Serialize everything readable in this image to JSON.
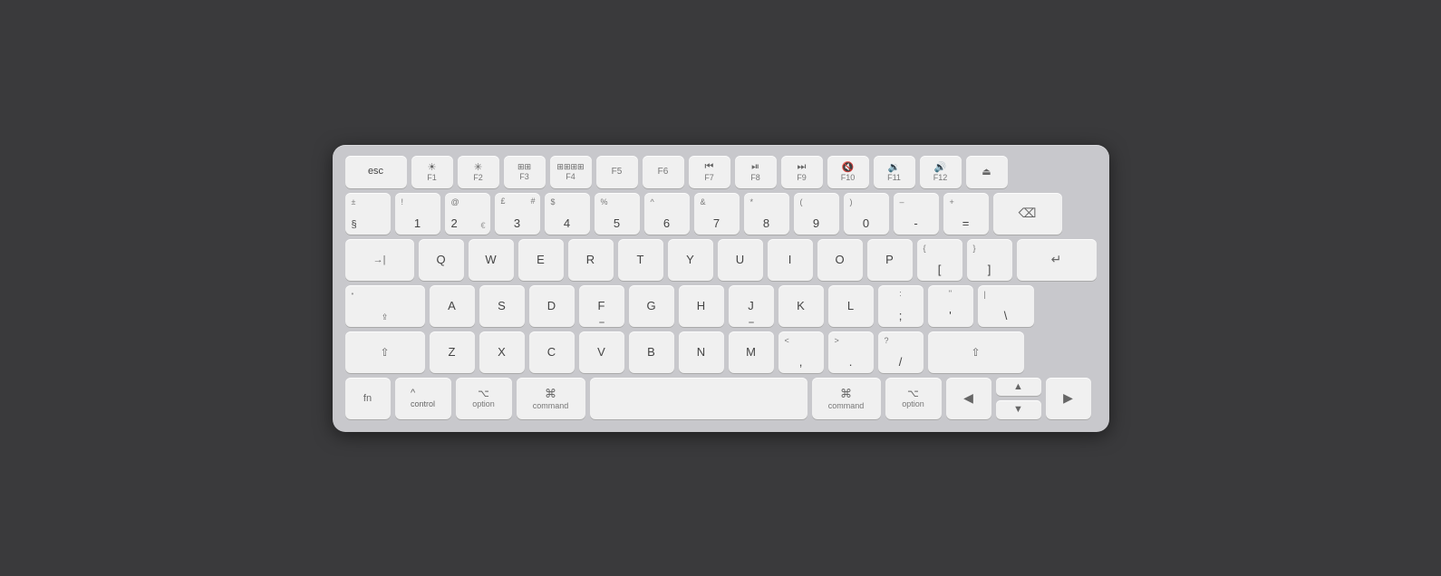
{
  "keyboard": {
    "background_color": "#c8c8cc",
    "rows": {
      "fn_row": [
        "esc",
        "F1",
        "F2",
        "F3",
        "F4",
        "F5",
        "F6",
        "F7",
        "F8",
        "F9",
        "F10",
        "F11",
        "F12",
        "eject"
      ],
      "num_row": [
        "§±",
        "1!",
        "2@€",
        "3#£",
        "4$",
        "5%",
        "6^",
        "7&",
        "8*",
        "9(",
        "0)",
        "-–",
        "+=",
        "delete"
      ],
      "qwerty_row": [
        "tab",
        "Q",
        "W",
        "E",
        "R",
        "T",
        "Y",
        "U",
        "I",
        "O",
        "P",
        "[{",
        "]}",
        "return"
      ],
      "home_row": [
        "caps",
        "A",
        "S",
        "D",
        "F",
        "G",
        "H",
        "J",
        "K",
        "L",
        ";:",
        "'\"",
        "\\|"
      ],
      "shift_row": [
        "shift_l",
        "Z",
        "X",
        "C",
        "V",
        "B",
        "N",
        "M",
        ",<",
        ".>",
        "/?",
        "shift_r"
      ],
      "bottom_row": [
        "fn",
        "control",
        "option_l",
        "command_l",
        "space",
        "command_r",
        "option_r",
        "left",
        "up_down",
        "right"
      ]
    }
  }
}
